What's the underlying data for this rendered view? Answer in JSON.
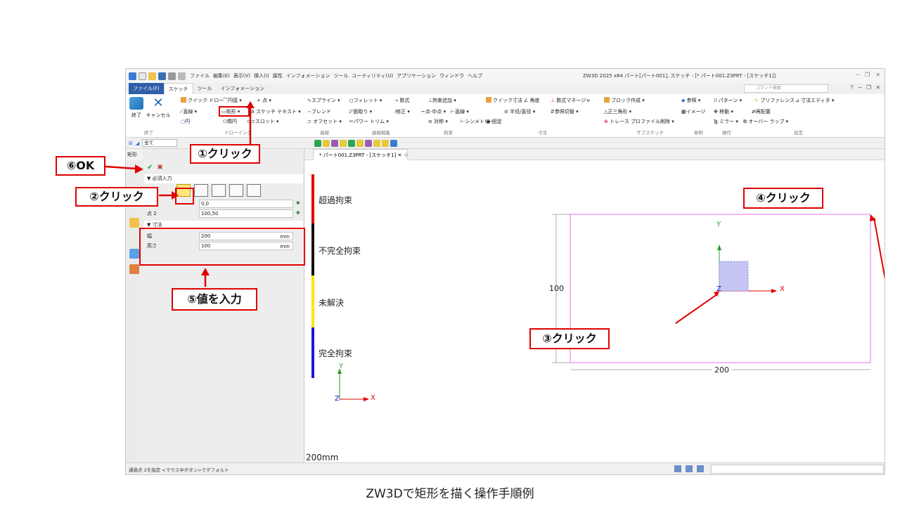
{
  "window": {
    "title": "ZW3D 2025 x64    パート[パート001], スケッチ - [* パート001.Z3PRT - [スケッチ1]]",
    "menus": [
      "ファイル",
      "編集(E)",
      "表示(V)",
      "挿入(I)",
      "属性",
      "インフォメーション",
      "ツール",
      "ユーティリティ(U)",
      "アプリケーション",
      "ウィンドウ",
      "ヘルプ"
    ]
  },
  "tabs": {
    "file": "ファイル(F)",
    "sketch": "スケッチ",
    "tool": "ツール",
    "info": "インフォメーション",
    "command_search_placeholder": "コマンド検索"
  },
  "ribbon": {
    "finish": "終了",
    "cancel": "キャンセル",
    "draw": {
      "quick_draw": "クイック ドロー",
      "arc": "円弧",
      "point": "点",
      "line": "直線",
      "rectangle": "矩形",
      "sketch_text": "スケッチ テキスト",
      "circle": "円",
      "ellipse": "楕円",
      "slot": "スロット"
    },
    "curves": {
      "spline": "スプライン",
      "blend": "ブレンド",
      "offset": "オフセット"
    },
    "edit": {
      "fillet": "フィレット",
      "chamfer": "面取り",
      "power_trim": "パワー トリム",
      "formula": "数式",
      "modify": "修正",
      "intersect": "点-中点"
    },
    "constraints": {
      "add_constraint": "拘束追加",
      "horizontal": "直線",
      "symmetric": "対称",
      "symmetry_line": "シンメトリー"
    },
    "dimension": {
      "quick_dim": "クイック寸法",
      "angle": "角度",
      "radius": "半径/直径",
      "reference_switch": "参照切替",
      "fix": "固定",
      "tag": "寸法"
    },
    "formula_manager": "数式マネージャ",
    "block_create": "ブロック作成",
    "triangle": "正三角形",
    "trace_profile_delete": "トレース プロファイル削除",
    "reference": "参照",
    "image": "イメージ",
    "pattern": "パターン",
    "move": "移動",
    "mirror": "ミラー",
    "preference": "プリファレンス",
    "dim_editor": "寸法エディタ",
    "realign": "再配置",
    "overlap": "オーバー ラップ",
    "groups": {
      "end": "終了",
      "drawing": "ドローイング",
      "curve": "曲線",
      "curve_edit": "曲線編集",
      "constraint": "拘束",
      "dimension": "寸法",
      "sub_sketch": "サブスケッチ",
      "ref": "参照",
      "operation": "操作",
      "settings": "設定"
    }
  },
  "filter": {
    "label": "全て"
  },
  "panel": {
    "title": "矩形",
    "ok": "✔",
    "cancel": "✖",
    "required_input": "必須入力",
    "point1_label": "点 1",
    "point1_value": "0,0",
    "point2_label": "点 2",
    "point2_value": "100,50",
    "dimension_section": "寸法",
    "width_label": "幅",
    "width_value": "200",
    "height_label": "高さ",
    "height_value": "100",
    "unit": "mm"
  },
  "doc_tab": "* パート001.Z3PRT - [スケッチ1]",
  "canvas": {
    "legend": [
      {
        "label": "超過拘束",
        "color": "#e00000"
      },
      {
        "label": "不完全拘束",
        "color": "#111111"
      },
      {
        "label": "未解決",
        "color": "#ffe600"
      },
      {
        "label": "完全拘束",
        "color": "#1a1ad6"
      }
    ],
    "dim_height": "100",
    "dim_width": "200",
    "scale_text": "200mm",
    "axis_x": "X",
    "axis_y": "Y",
    "axis_z": "Z"
  },
  "statusbar": {
    "text": "通過点 2を指定 <マウス中ボタン>でデフォルト"
  },
  "callouts": {
    "c1": "①クリック",
    "c2": "②クリック",
    "c3": "③クリック",
    "c4": "④クリック",
    "c5": "⑤値を入力",
    "c6": "⑥OK"
  },
  "caption": "ZW3Dで矩形を描く操作手順例",
  "colors": {
    "accent": "#e00000",
    "file_tab": "#2f5ea8",
    "sketch_line": "#e573e5",
    "selected_mode": "#ffe680"
  }
}
